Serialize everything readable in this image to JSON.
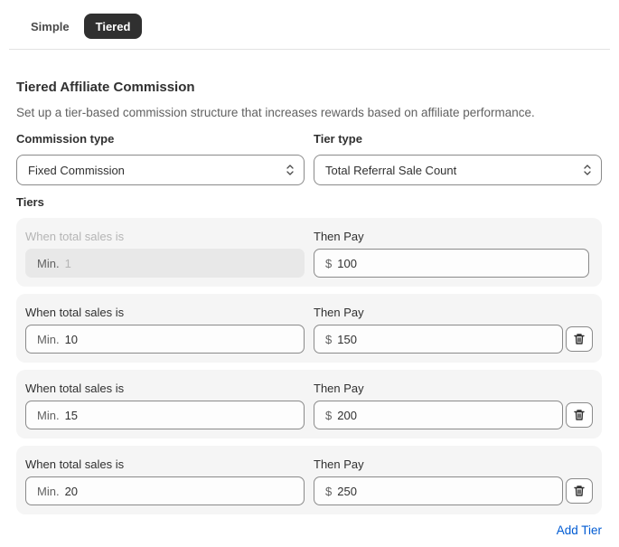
{
  "tabs": [
    {
      "label": "Simple",
      "active": false
    },
    {
      "label": "Tiered",
      "active": true
    }
  ],
  "section": {
    "title": "Tiered Affiliate Commission",
    "description": "Set up a tier-based commission structure that increases rewards based on affiliate performance."
  },
  "commission_type": {
    "label": "Commission type",
    "value": "Fixed Commission"
  },
  "tier_type": {
    "label": "Tier type",
    "value": "Total Referral Sale Count"
  },
  "tiers_label": "Tiers",
  "tiers": [
    {
      "when_label": "When total sales is",
      "min_prefix": "Min.",
      "min_value": "1",
      "pay_label": "Then Pay",
      "currency": "$",
      "pay_value": "100",
      "deletable": false
    },
    {
      "when_label": "When total sales is",
      "min_prefix": "Min.",
      "min_value": "10",
      "pay_label": "Then Pay",
      "currency": "$",
      "pay_value": "150",
      "deletable": true
    },
    {
      "when_label": "When total sales is",
      "min_prefix": "Min.",
      "min_value": "15",
      "pay_label": "Then Pay",
      "currency": "$",
      "pay_value": "200",
      "deletable": true
    },
    {
      "when_label": "When total sales is",
      "min_prefix": "Min.",
      "min_value": "20",
      "pay_label": "Then Pay",
      "currency": "$",
      "pay_value": "250",
      "deletable": true
    }
  ],
  "add_tier_label": "Add Tier",
  "colors": {
    "accent": "#005bd3",
    "tab_active": "#303030"
  }
}
